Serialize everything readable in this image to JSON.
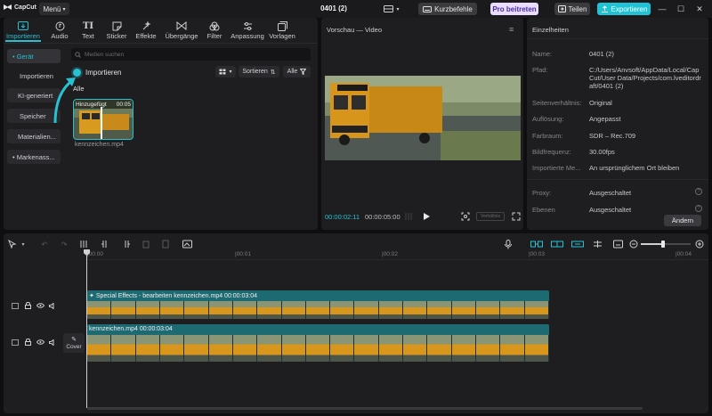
{
  "app": {
    "name": "CapCut",
    "menu_label": "Menü",
    "project_title": "0401 (2)"
  },
  "titlebar": {
    "shortcuts_label": "Kurzbefehle",
    "pro_label": "Pro beitreten",
    "share_label": "Teilen",
    "export_label": "Exportieren",
    "colors": {
      "accent": "#27c1d1",
      "pro_bg": "#e9dcff",
      "export_bg": "#1fc3d6"
    }
  },
  "toolbar_tabs": [
    {
      "label": "Importieren",
      "icon": "import-icon",
      "active": true
    },
    {
      "label": "Audio",
      "icon": "audio-icon",
      "active": false
    },
    {
      "label": "Text",
      "icon": "text-icon",
      "active": false
    },
    {
      "label": "Sticker",
      "icon": "sticker-icon",
      "active": false
    },
    {
      "label": "Effekte",
      "icon": "effects-icon",
      "active": false
    },
    {
      "label": "Übergänge",
      "icon": "transitions-icon",
      "active": false
    },
    {
      "label": "Filter",
      "icon": "filter-icon",
      "active": false
    },
    {
      "label": "Anpassung",
      "icon": "adjust-icon",
      "active": false
    },
    {
      "label": "Vorlagen",
      "icon": "templates-icon",
      "active": false
    }
  ],
  "media_sidebar": [
    {
      "label": "• Gerät",
      "active": true
    },
    {
      "label": "Importieren",
      "active": false
    },
    {
      "label": "KI-generiert",
      "active": false
    },
    {
      "label": "Speicher",
      "active": false
    },
    {
      "label": "Materialien...",
      "active": false
    },
    {
      "label": "• Markenass...",
      "active": false
    }
  ],
  "media": {
    "search_placeholder": "Medien suchen",
    "import_label": "Importieren",
    "sort_label": "Sortieren",
    "filter_label": "Alle",
    "all_label": "Alle",
    "clip": {
      "badge": "Hinzugefügt",
      "duration": "00:05",
      "filename": "kennzeichen.mp4"
    }
  },
  "preview": {
    "title": "Vorschau — Video",
    "current_time": "00:00:02:11",
    "total_time": "00:00:05:00",
    "ratio_label": "Verhältnis"
  },
  "details": {
    "title": "Einzelheiten",
    "rows": [
      {
        "key": "Name:",
        "value": "0401 (2)"
      },
      {
        "key": "Pfad:",
        "value": "C:/Users/Anvsoft/AppData/Local/CapCut/User Data/Projects/com.lveditordraft/0401 (2)"
      },
      {
        "key": "Seitenverhältnis:",
        "value": "Original"
      },
      {
        "key": "Auflösung:",
        "value": "Angepasst"
      },
      {
        "key": "Farbraum:",
        "value": "SDR – Rec.709"
      },
      {
        "key": "Bildfrequenz:",
        "value": "30.00fps"
      },
      {
        "key": "Importierte Me...",
        "value": "An ursprünglichem Ort bleiben"
      },
      {
        "key": "Proxy:",
        "value": "Ausgeschaltet"
      },
      {
        "key": "Ebenen",
        "value": "Ausgeschaltet"
      }
    ],
    "change_label": "Ändern"
  },
  "timeline": {
    "ruler": [
      "|00:00",
      "|00:01",
      "|00:02",
      "|00:03",
      "|00:04"
    ],
    "effects_clip_label": "Special Effects - bearbeiten  kennzeichen.mp4  00:00:03:04",
    "main_clip_label": "kennzeichen.mp4  00:00:03:04",
    "cover_label": "Cover",
    "zoom_level": 0.45
  }
}
